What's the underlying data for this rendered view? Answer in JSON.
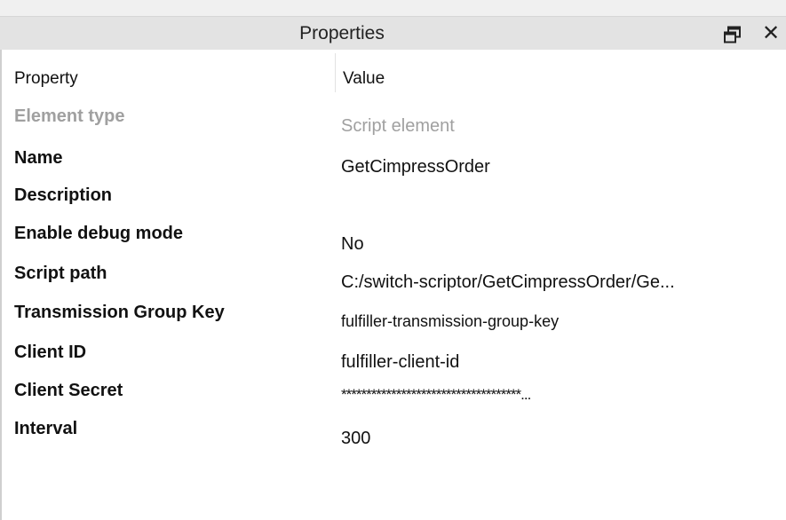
{
  "panel": {
    "title": "Properties"
  },
  "table": {
    "headers": {
      "property": "Property",
      "value": "Value"
    },
    "rows": [
      {
        "property": "Element type",
        "value": "Script element",
        "disabled": true
      },
      {
        "property": "Name",
        "value": "GetCimpressOrder"
      },
      {
        "property": "Description",
        "value": ""
      },
      {
        "property": "Enable debug mode",
        "value": "No"
      },
      {
        "property": "Script path",
        "value": "C:/switch-scriptor/GetCimpressOrder/Ge..."
      },
      {
        "property": "Transmission Group Key",
        "value": "fulfiller-transmission-group-key"
      },
      {
        "property": "Client ID",
        "value": "fulfiller-client-id"
      },
      {
        "property": "Client Secret",
        "value": "************************************..."
      },
      {
        "property": "Interval",
        "value": "300"
      }
    ]
  },
  "icons": {
    "float": "float-window-icon",
    "close": "close-icon"
  }
}
